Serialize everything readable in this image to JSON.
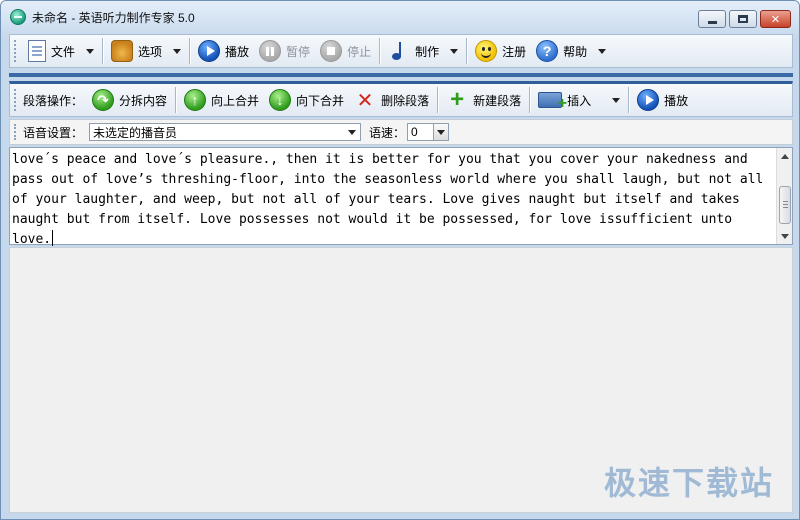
{
  "window": {
    "title": "未命名 - 英语听力制作专家 5.0"
  },
  "toolbar_main": {
    "file": "文件",
    "options": "选项",
    "play": "播放",
    "pause": "暂停",
    "stop": "停止",
    "make": "制作",
    "register": "注册",
    "help": "帮助"
  },
  "toolbar_paragraph": {
    "label": "段落操作：",
    "split": "分拆内容",
    "merge_up": "向上合并",
    "merge_down": "向下合并",
    "delete": "删除段落",
    "new": "新建段落",
    "insert": "插入",
    "play": "播放"
  },
  "voice_settings": {
    "label": "语音设置：",
    "speaker_value": "未选定的播音员",
    "speed_label": "语速：",
    "speed_value": "0"
  },
  "editor": {
    "text": "love´s peace and love´s pleasure., then it is better for you that you cover your nakedness and pass out of love’s threshing-floor, into the seasonless world where you shall laugh, but not all of your laughter, and weep, but not all of your tears. Love gives naught but itself and takes naught but from itself. Love possesses not would it be possessed, for love issufficient unto love."
  },
  "watermark": "极速下载站",
  "icons": {
    "app": "app-globe-icon",
    "file": "document-icon",
    "options": "gear-icon",
    "play": "play-icon",
    "pause": "pause-icon",
    "stop": "stop-icon",
    "make": "music-note-icon",
    "register": "smiley-icon",
    "help": "question-icon"
  }
}
